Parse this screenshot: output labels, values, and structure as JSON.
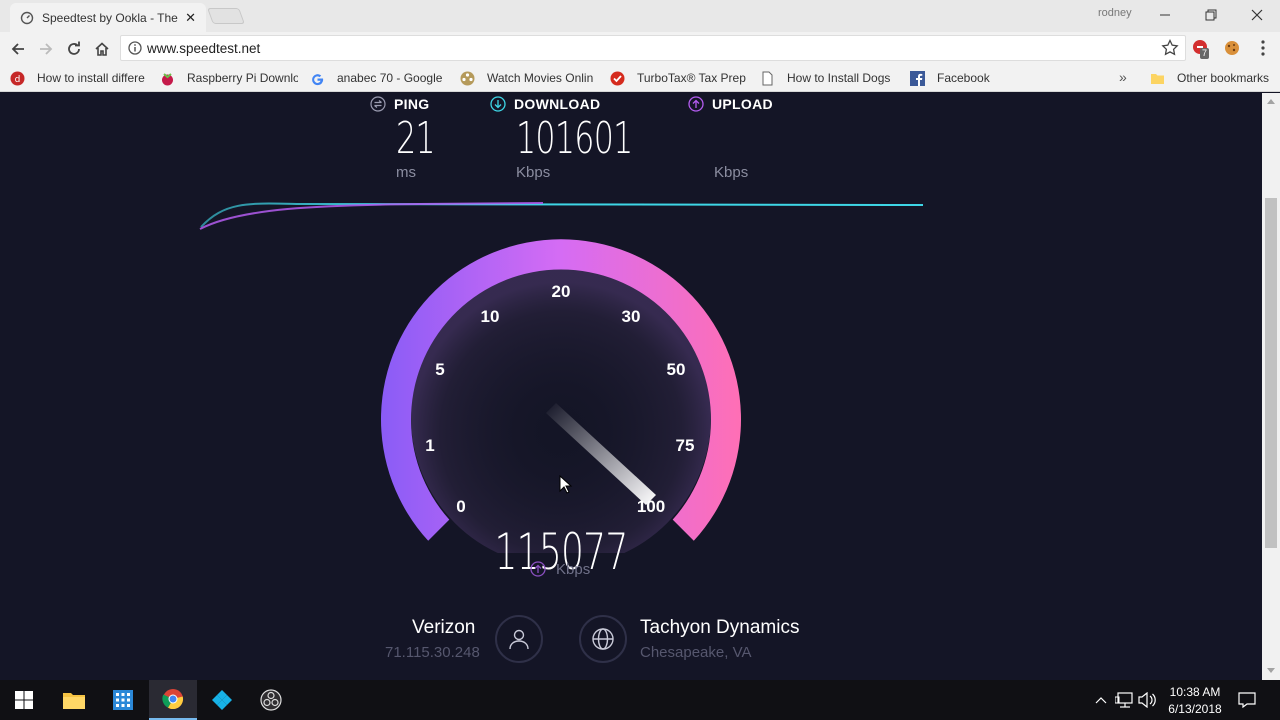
{
  "browser": {
    "tab": {
      "title": "Speedtest by Ookla - The",
      "close": "✕"
    },
    "profile": "rodney",
    "url": "www.speedtest.net",
    "extension_badge": "7",
    "bookmarks": [
      {
        "label": "How to install differe",
        "icon": "red-circle-icon"
      },
      {
        "label": "Raspberry Pi Downlo",
        "icon": "raspberry-icon"
      },
      {
        "label": "anabec 70 - Google",
        "icon": "google-icon"
      },
      {
        "label": "Watch Movies Onlin",
        "icon": "film-reel-icon"
      },
      {
        "label": "TurboTax® Tax Prep",
        "icon": "check-circle-icon"
      },
      {
        "label": "How to Install Dogs",
        "icon": "page-icon"
      },
      {
        "label": "Facebook",
        "icon": "facebook-icon"
      }
    ],
    "overflow": "»",
    "other_bookmarks": "Other bookmarks"
  },
  "speedtest": {
    "ping": {
      "label": "PING",
      "value": "21",
      "unit": "ms"
    },
    "download": {
      "label": "DOWNLOAD",
      "value": "101601",
      "unit": "Kbps"
    },
    "upload": {
      "label": "UPLOAD",
      "value": "",
      "unit": "Kbps"
    },
    "gauge": {
      "ticks": [
        "0",
        "1",
        "5",
        "10",
        "20",
        "30",
        "50",
        "75",
        "100"
      ],
      "needle_value": 100,
      "current_value": "115077",
      "current_unit": "Kbps"
    },
    "isp": {
      "name": "Verizon",
      "ip": "71.115.30.248"
    },
    "server": {
      "name": "Tachyon Dynamics",
      "location": "Chesapeake, VA"
    },
    "colors": {
      "background": "#141526",
      "gauge_start": "#8a5cf6",
      "gauge_end": "#ff6fb5",
      "line_cyan": "#3ed6e6",
      "line_purple": "#b45cf0"
    }
  },
  "taskbar": {
    "apps": [
      "windows-start-icon",
      "file-explorer-icon",
      "calculator-icon",
      "chrome-icon",
      "kodi-icon",
      "obs-icon"
    ],
    "time": "10:38 AM",
    "date": "6/13/2018"
  }
}
